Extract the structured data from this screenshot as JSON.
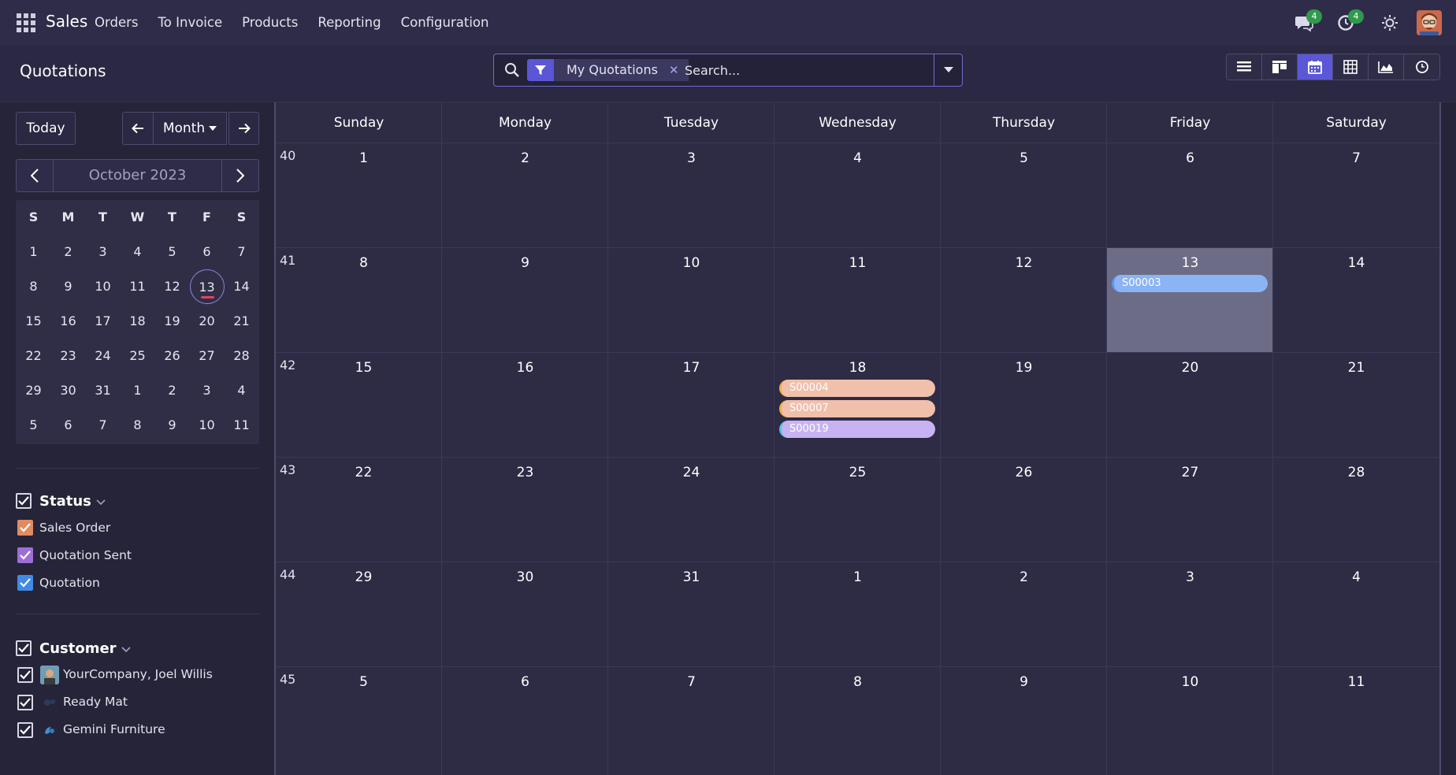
{
  "nav": {
    "brand": "Sales",
    "menu": [
      "Orders",
      "To Invoice",
      "Products",
      "Reporting",
      "Configuration"
    ],
    "chat_badge": "4",
    "activity_badge": "4"
  },
  "control_panel": {
    "title": "Quotations",
    "facet": "My Quotations",
    "search_placeholder": "Search..."
  },
  "sidebar": {
    "today_label": "Today",
    "scale_label": "Month",
    "mini_title": "October 2023",
    "weekdays": [
      "S",
      "M",
      "T",
      "W",
      "T",
      "F",
      "S"
    ],
    "weeks": [
      [
        "1",
        "2",
        "3",
        "4",
        "5",
        "6",
        "7"
      ],
      [
        "8",
        "9",
        "10",
        "11",
        "12",
        "13",
        "14"
      ],
      [
        "15",
        "16",
        "17",
        "18",
        "19",
        "20",
        "21"
      ],
      [
        "22",
        "23",
        "24",
        "25",
        "26",
        "27",
        "28"
      ],
      [
        "29",
        "30",
        "31",
        "1",
        "2",
        "3",
        "4"
      ],
      [
        "5",
        "6",
        "7",
        "8",
        "9",
        "10",
        "11"
      ]
    ],
    "today_day": "13",
    "status_filter": {
      "title": "Status",
      "items": [
        {
          "label": "Sales Order",
          "color": "#e08c5f"
        },
        {
          "label": "Quotation Sent",
          "color": "#9c6ed6"
        },
        {
          "label": "Quotation",
          "color": "#3f8be6"
        }
      ]
    },
    "customer_filter": {
      "title": "Customer",
      "items": [
        {
          "label": "YourCompany, Joel Willis"
        },
        {
          "label": "Ready Mat"
        },
        {
          "label": "Gemini Furniture"
        }
      ]
    }
  },
  "calendar": {
    "days": [
      "Sunday",
      "Monday",
      "Tuesday",
      "Wednesday",
      "Thursday",
      "Friday",
      "Saturday"
    ],
    "week_numbers": [
      "40",
      "41",
      "42",
      "43",
      "44",
      "45"
    ],
    "weeks": [
      [
        "1",
        "2",
        "3",
        "4",
        "5",
        "6",
        "7"
      ],
      [
        "8",
        "9",
        "10",
        "11",
        "12",
        "13",
        "14"
      ],
      [
        "15",
        "16",
        "17",
        "18",
        "19",
        "20",
        "21"
      ],
      [
        "22",
        "23",
        "24",
        "25",
        "26",
        "27",
        "28"
      ],
      [
        "29",
        "30",
        "31",
        "1",
        "2",
        "3",
        "4"
      ],
      [
        "5",
        "6",
        "7",
        "8",
        "9",
        "10",
        "11"
      ]
    ],
    "today": {
      "week": 1,
      "day": 5
    },
    "events": [
      {
        "name": "S00003",
        "week": 1,
        "day": 5,
        "slot": 0,
        "color": "#8ab4f4",
        "accent": "#5f95e8"
      },
      {
        "name": "S00004",
        "week": 2,
        "day": 3,
        "slot": 0,
        "color": "#f0c0ab",
        "accent": "#f2b04a"
      },
      {
        "name": "S00007",
        "week": 2,
        "day": 3,
        "slot": 1,
        "color": "#f0c0ab",
        "accent": "#f2b04a"
      },
      {
        "name": "S00019",
        "week": 2,
        "day": 3,
        "slot": 2,
        "color": "#c7b3f2",
        "accent": "#5bc0d8"
      }
    ]
  }
}
